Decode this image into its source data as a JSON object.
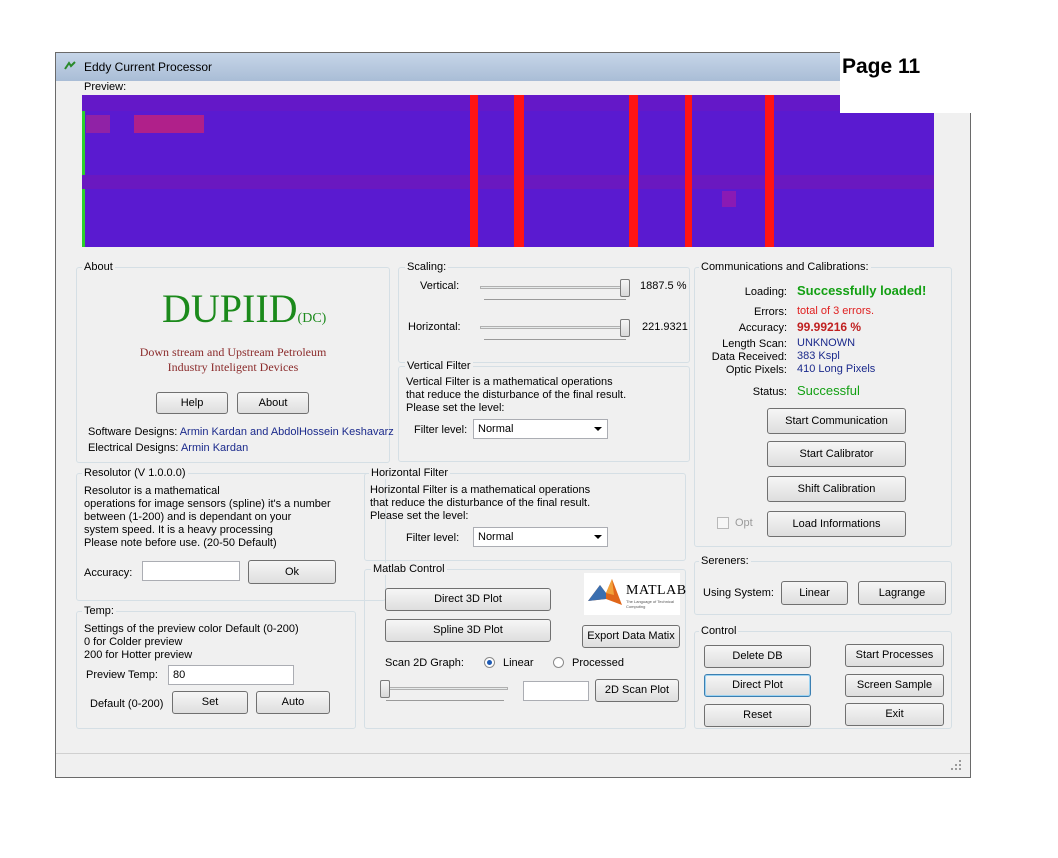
{
  "page_label": "Page 11",
  "window": {
    "title": "Eddy Current Processor"
  },
  "preview": {
    "label": "Preview:",
    "colors": {
      "background": "#5a1ad0",
      "stripe": "#ff1414",
      "left_edge": "#2bd12b",
      "mid": "#7a1ab0"
    }
  },
  "about": {
    "title": "About",
    "logo_main": "DUPIID",
    "logo_sub": "(DC)",
    "tagline1": "Down stream and Upstream Petroleum",
    "tagline2": "Industry Inteligent Devices",
    "help_button": "Help",
    "about_button": "About",
    "software_label": "Software Designs:",
    "software_names": "Armin Kardan and AbdolHossein Keshavarz",
    "electrical_label": "Electrical Designs:",
    "electrical_names": "Armin Kardan",
    "colors": {
      "logo": "#1b8a1b",
      "tagline": "#8b2b2b"
    }
  },
  "scaling": {
    "title": "Scaling:",
    "vertical_label": "Vertical:",
    "vertical_value": "1887.5 %",
    "horizontal_label": "Horizontal:",
    "horizontal_value": "221.9321"
  },
  "vertical_filter": {
    "title": "Vertical Filter",
    "desc1": "Vertical Filter is a mathematical operations",
    "desc2": "that reduce the disturbance of the final result.",
    "desc3": "Please set the  level:",
    "level_label": "Filter level:",
    "level_value": "Normal"
  },
  "communications": {
    "title": "Communications and Calibrations:",
    "loading_label": "Loading:",
    "loading_value": "Successfully loaded!",
    "errors_label": "Errors:",
    "errors_value": "total of 3 errors.",
    "accuracy_label": "Accuracy:",
    "accuracy_value": "99.99216 %",
    "length_label": "Length Scan:",
    "length_value": "UNKNOWN",
    "received_label": "Data Received:",
    "received_value": "383 Kspl",
    "pixels_label": "Optic Pixels:",
    "pixels_value": "410 Long Pixels",
    "status_label": "Status:",
    "status_value": "Successful",
    "start_comm": "Start Communication",
    "start_calib": "Start Calibrator",
    "shift_calib": "Shift Calibration",
    "load_info": "Load Informations",
    "opt_label": "Opt",
    "colors": {
      "success": "#13a013",
      "error": "#e02020",
      "accuracy": "#c02020",
      "info": "#1b2a8c"
    }
  },
  "resolutor": {
    "title": "Resolutor (V 1.0.0.0)",
    "desc1": "Resolutor is a mathematical",
    "desc2": "operations for image sensors (spline) it's a number",
    "desc3": "between (1-200) and is dependant on your",
    "desc4": "system speed. It is a heavy processing",
    "desc5": "Please note before use.   (20-50 Default)",
    "accuracy_label": "Accuracy:",
    "accuracy_value": "",
    "ok_button": "Ok"
  },
  "horizontal_filter": {
    "title": "Horizontal Filter",
    "desc1": "Horizontal Filter is a mathematical operations",
    "desc2": "that reduce the disturbance of the final result.",
    "desc3": "Please set the  level:",
    "level_label": "Filter level:",
    "level_value": "Normal"
  },
  "sereners": {
    "title": "Sereners:",
    "using_label": "Using System:",
    "linear_button": "Linear",
    "lagrange_button": "Lagrange"
  },
  "temp": {
    "title": "Temp:",
    "desc1": "Settings of the preview color Default (0-200)",
    "desc2": "0 for Colder preview",
    "desc3": "200 for Hotter preview",
    "preview_label": "Preview Temp:",
    "preview_value": "80",
    "default_label": "Default (0-200)",
    "set_button": "Set",
    "auto_button": "Auto"
  },
  "matlab": {
    "title": "Matlab Control",
    "direct3d": "Direct 3D Plot",
    "spline3d": "Spline 3D Plot",
    "export": "Export Data Matix",
    "scan_label": "Scan 2D Graph:",
    "linear_label": "Linear",
    "processed_label": "Processed",
    "scan_value": "",
    "scan2d": "2D Scan Plot",
    "logo_text": "MATLAB",
    "logo_sub": "The Language of Technical Computing",
    "linear_selected": true
  },
  "control": {
    "title": "Control",
    "delete_db": "Delete DB",
    "start_processes": "Start Processes",
    "direct_plot": "Direct Plot",
    "screen_sample": "Screen Sample",
    "reset": "Reset",
    "exit": "Exit"
  }
}
